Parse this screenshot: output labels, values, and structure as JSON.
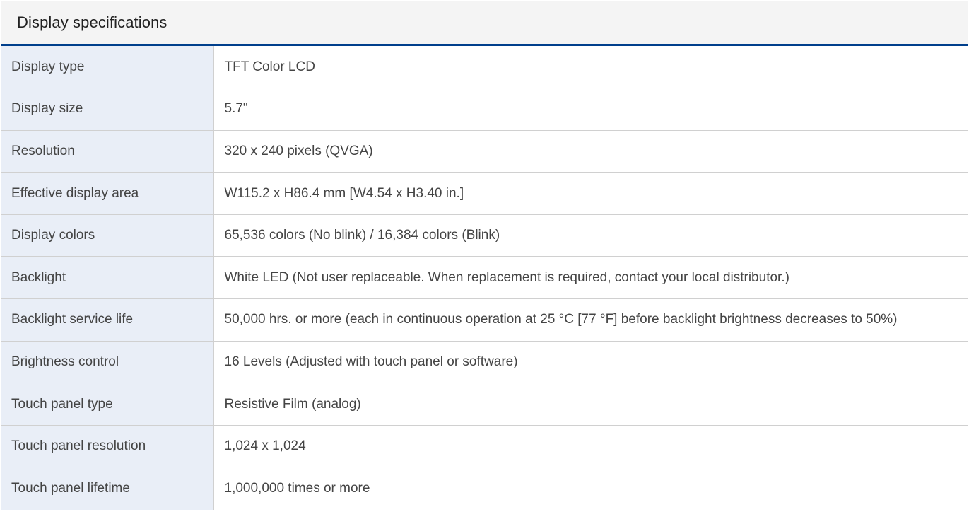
{
  "panel": {
    "title": "Display specifications"
  },
  "specs": [
    {
      "label": "Display type",
      "value": "TFT Color LCD"
    },
    {
      "label": "Display size",
      "value": "5.7\""
    },
    {
      "label": "Resolution",
      "value": "320 x 240 pixels (QVGA)"
    },
    {
      "label": "Effective display area",
      "value": "W115.2 x H86.4 mm [W4.54 x H3.40 in.]"
    },
    {
      "label": "Display colors",
      "value": "65,536 colors (No blink) / 16,384 colors (Blink)"
    },
    {
      "label": "Backlight",
      "value": "White LED (Not user replaceable. When replacement is required, contact your local distributor.)"
    },
    {
      "label": "Backlight service life",
      "value": "50,000 hrs. or more (each in continuous operation at 25 °C [77 °F] before backlight brightness decreases to 50%)"
    },
    {
      "label": "Brightness control",
      "value": "16 Levels (Adjusted with touch panel or software)"
    },
    {
      "label": "Touch panel type",
      "value": "Resistive Film (analog)"
    },
    {
      "label": "Touch panel resolution",
      "value": "1,024 x 1,024"
    },
    {
      "label": "Touch panel lifetime",
      "value": "1,000,000 times or more"
    }
  ],
  "colors": {
    "header_background": "#f4f4f4",
    "header_rule": "#003f8c",
    "label_background": "#e9eef7",
    "border": "#d0d0d0"
  }
}
